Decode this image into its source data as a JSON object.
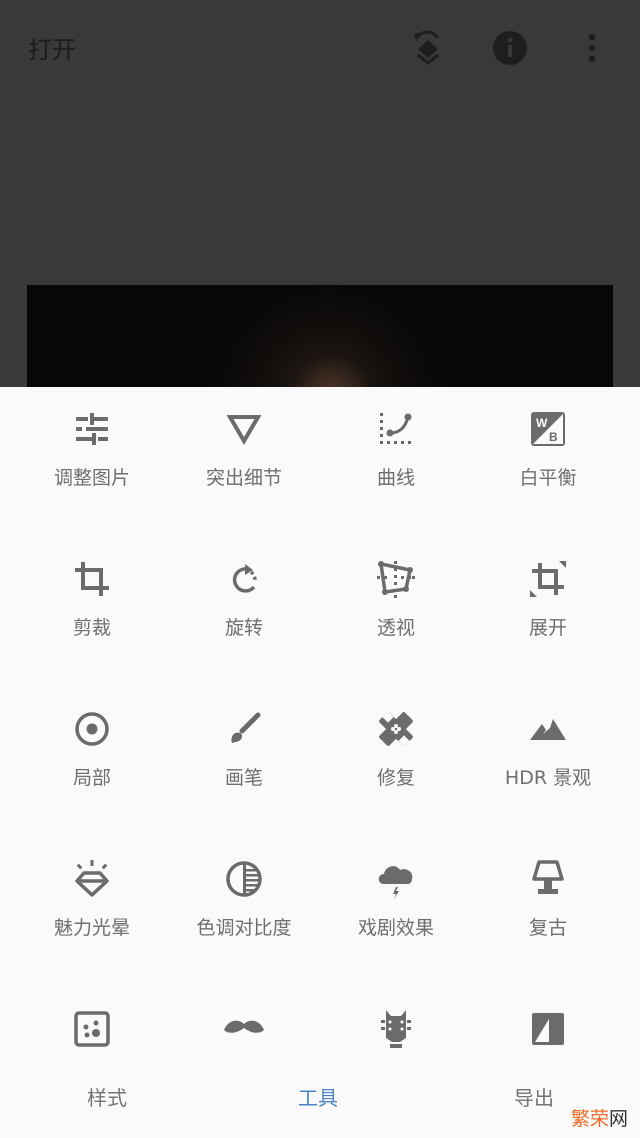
{
  "topbar": {
    "open_label": "打开",
    "icons": [
      "layers-undo-icon",
      "info-icon",
      "more-vert-icon"
    ]
  },
  "tools": [
    {
      "label": "调整图片",
      "icon": "tune-sliders-icon"
    },
    {
      "label": "突出细节",
      "icon": "details-triangle-icon"
    },
    {
      "label": "曲线",
      "icon": "curves-icon"
    },
    {
      "label": "白平衡",
      "icon": "white-balance-icon"
    },
    {
      "label": "剪裁",
      "icon": "crop-icon"
    },
    {
      "label": "旋转",
      "icon": "rotate-icon"
    },
    {
      "label": "透视",
      "icon": "perspective-icon"
    },
    {
      "label": "展开",
      "icon": "expand-icon"
    },
    {
      "label": "局部",
      "icon": "selective-icon"
    },
    {
      "label": "画笔",
      "icon": "brush-icon"
    },
    {
      "label": "修复",
      "icon": "healing-bandage-icon"
    },
    {
      "label": "HDR 景观",
      "icon": "hdr-mountain-icon"
    },
    {
      "label": "魅力光晕",
      "icon": "glamour-glow-diamond-icon"
    },
    {
      "label": "色调对比度",
      "icon": "tonal-contrast-icon"
    },
    {
      "label": "戏剧效果",
      "icon": "drama-cloud-icon"
    },
    {
      "label": "复古",
      "icon": "vintage-lamp-icon"
    },
    {
      "label": "",
      "icon": "grainy-film-icon"
    },
    {
      "label": "",
      "icon": "retrolux-mustache-icon"
    },
    {
      "label": "",
      "icon": "grunge-guitar-icon"
    },
    {
      "label": "",
      "icon": "black-white-icon"
    }
  ],
  "bottom_nav": {
    "items": [
      {
        "label": "样式",
        "active": false
      },
      {
        "label": "工具",
        "active": true
      },
      {
        "label": "导出",
        "active": false
      }
    ]
  },
  "watermark": {
    "part1": "繁荣",
    "part2": "网"
  },
  "colors": {
    "accent": "#4a84c4",
    "icon_gray": "#6b6b6b",
    "sheet_bg": "#fafafa",
    "dim_bg": "#393939",
    "watermark_orange": "#ef6a24"
  }
}
